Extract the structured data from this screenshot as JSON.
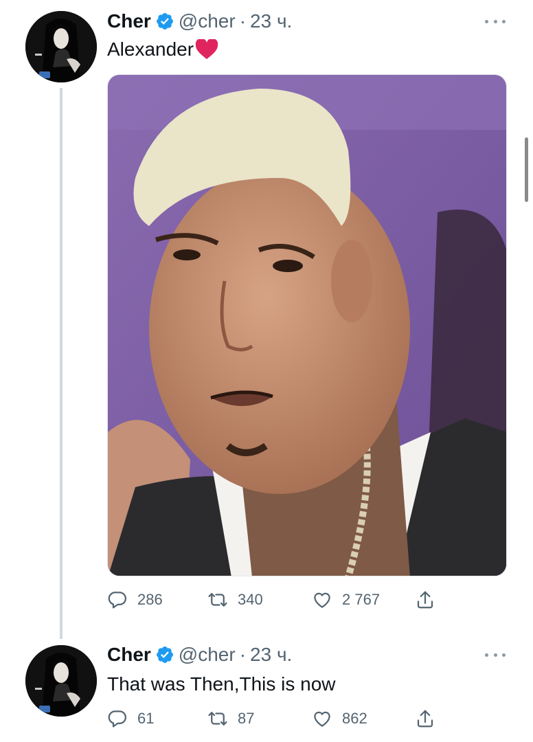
{
  "tweets": [
    {
      "author_name": "Cher",
      "handle": "@cher",
      "separator": "·",
      "time": "23 ч.",
      "text": "Alexander",
      "emoji": "heart-emoji",
      "has_media": true,
      "stats": {
        "replies": "286",
        "retweets": "340",
        "likes": "2 767"
      }
    },
    {
      "author_name": "Cher",
      "handle": "@cher",
      "separator": "·",
      "time": "23 ч.",
      "text": "That was Then,This is now",
      "has_media": false,
      "stats": {
        "replies": "61",
        "retweets": "87",
        "likes": "862"
      }
    }
  ],
  "icons": {
    "more": "more-horizontal-icon",
    "verified": "verified-badge-icon",
    "reply": "reply-icon",
    "retweet": "retweet-icon",
    "like": "like-icon",
    "share": "share-icon"
  },
  "colors": {
    "text_primary": "#0f1419",
    "text_secondary": "#536471",
    "verified_blue": "#1d9bf0",
    "thread_line": "#cfd9de",
    "heart_red": "#e0245e"
  }
}
